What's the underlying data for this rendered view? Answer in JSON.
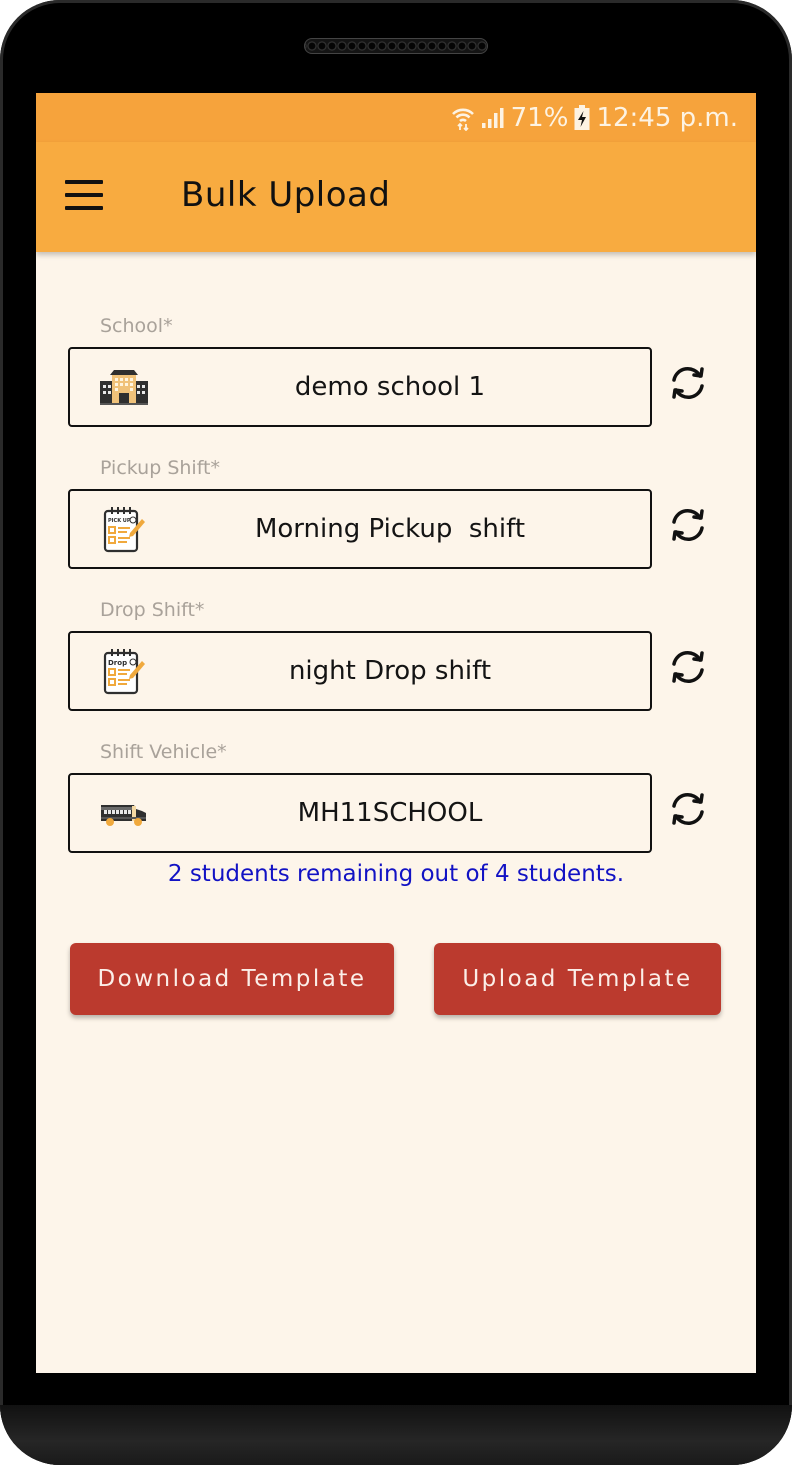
{
  "status_bar": {
    "battery_percent": "71%",
    "time": "12:45 p.m.",
    "icons": [
      "wifi-icon",
      "signal-icon",
      "battery-charging-icon"
    ]
  },
  "app_bar": {
    "title": "Bulk Upload",
    "menu_icon": "hamburger-menu-icon"
  },
  "form": {
    "fields": [
      {
        "label": "School*",
        "value": "demo school 1",
        "icon": "school-building-icon"
      },
      {
        "label": "Pickup Shift*",
        "value": "Morning Pickup  shift",
        "icon": "pickup-checklist-icon",
        "icon_text": "PICK UP"
      },
      {
        "label": "Drop Shift*",
        "value": "night Drop shift",
        "icon": "drop-checklist-icon",
        "icon_text": "Drop"
      },
      {
        "label": "Shift Vehicle*",
        "value": "MH11SCHOOL",
        "icon": "school-bus-icon"
      }
    ],
    "refresh_icon": "refresh-icon",
    "remaining_message": "2 students remaining out of 4 students."
  },
  "actions": {
    "download_label": "Download Template",
    "upload_label": "Upload Template"
  },
  "colors": {
    "status_bar": "#f6a33c",
    "app_bar": "#f8ab40",
    "background": "#fdf5ea",
    "button": "#bb3a2e",
    "message": "#1212c4",
    "label": "#a9a29a"
  }
}
